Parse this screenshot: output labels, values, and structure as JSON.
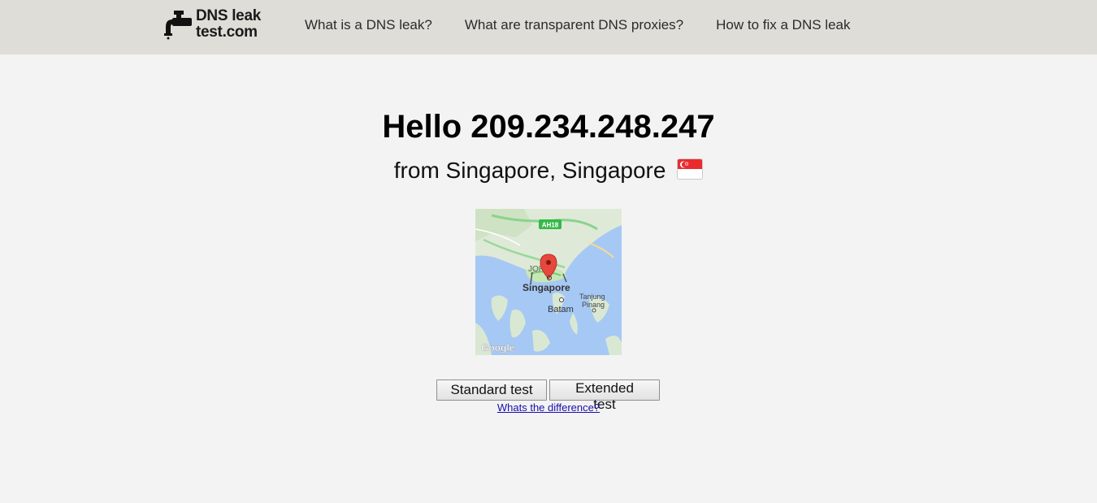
{
  "header": {
    "logo": {
      "line1": "DNS leak",
      "line2": "test.com",
      "icon": "faucet-icon"
    },
    "nav": [
      {
        "label": "What is a DNS leak?"
      },
      {
        "label": "What are transparent DNS proxies?"
      },
      {
        "label": "How to fix a DNS leak"
      }
    ]
  },
  "main": {
    "greeting": "Hello 209.234.248.247",
    "location": "from Singapore, Singapore",
    "flag": "singapore-flag-icon",
    "map": {
      "labels": {
        "highway": "AH18",
        "johor": "JOH",
        "city": "Singapore",
        "batam": "Batam",
        "tanjung": "Tanjung",
        "pinang": "Pinang",
        "attribution": "Google"
      },
      "marker": "map-pin-icon"
    },
    "buttons": {
      "standard": "Standard test",
      "extended": "Extended test"
    },
    "difference_link": "Whats the difference?"
  },
  "colors": {
    "header_bg": "#deddd8",
    "page_bg": "#f3f3f3",
    "link": "#1a0dab",
    "map_water": "#a6c8f5",
    "map_land": "#d9e8d3"
  }
}
